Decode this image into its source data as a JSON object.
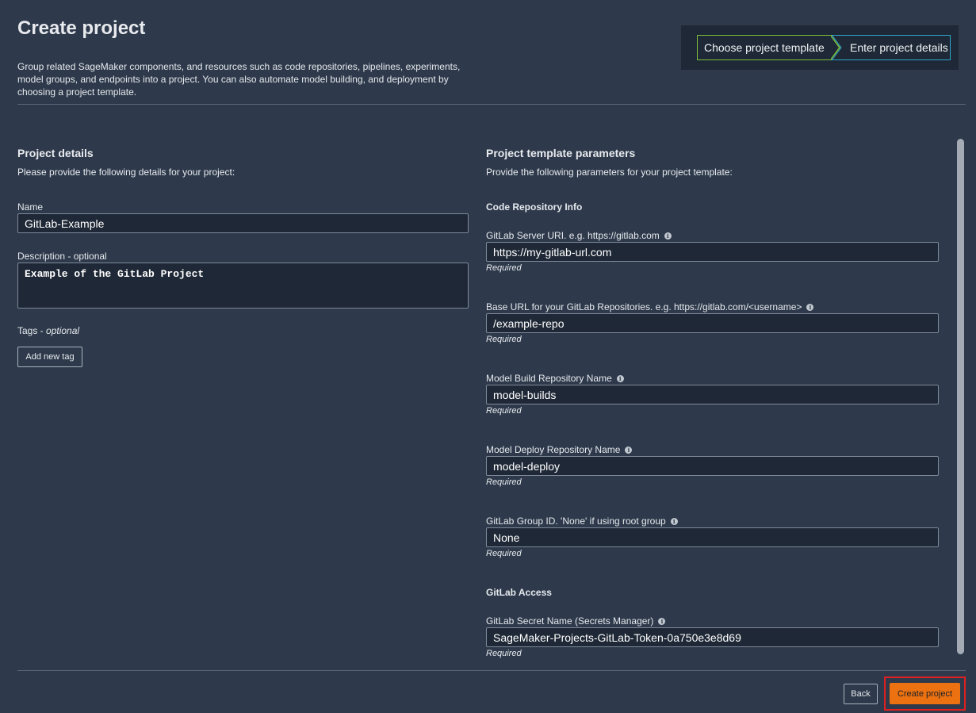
{
  "header": {
    "title": "Create project",
    "description": "Group related SageMaker components, and resources such as code repositories, pipelines, experiments, model groups, and endpoints into a project. You can also automate model building, and deployment by choosing a project template."
  },
  "steps": [
    "Choose project template",
    "Enter project details"
  ],
  "project_details": {
    "title": "Project details",
    "subtitle": "Please provide the following details for your project:",
    "name_label": "Name",
    "name_value": "GitLab-Example",
    "description_label": "Description - optional",
    "description_value": "Example of the GitLab Project",
    "tags_label": "Tags - ",
    "tags_optional": "optional",
    "add_tag_label": "Add new tag"
  },
  "template_params": {
    "title": "Project template parameters",
    "subtitle": "Provide the following parameters for your project template:",
    "code_repo_heading": "Code Repository Info",
    "required_text": "Required",
    "fields": [
      {
        "label": "GitLab Server URI. e.g. https://gitlab.com",
        "value": "https://my-gitlab-url.com"
      },
      {
        "label": "Base URL for your GitLab Repositories. e.g. https://gitlab.com/<username>",
        "value": "/example-repo"
      },
      {
        "label": "Model Build Repository Name",
        "value": "model-builds"
      },
      {
        "label": "Model Deploy Repository Name",
        "value": "model-deploy"
      },
      {
        "label": "GitLab Group ID. 'None' if using root group",
        "value": "None"
      }
    ],
    "access_heading": "GitLab Access",
    "secret_field": {
      "label": "GitLab Secret Name (Secrets Manager)",
      "value": "SageMaker-Projects-GitLab-Token-0a750e3e8d69"
    }
  },
  "footer": {
    "back_label": "Back",
    "create_label": "Create project"
  },
  "colors": {
    "background": "#2e3a4b",
    "primary_button": "#ec7211",
    "highlight": "#e02020",
    "step_done": "#7fbf3a",
    "step_current": "#2ea5c9"
  },
  "icons": {
    "info": "info-icon"
  }
}
